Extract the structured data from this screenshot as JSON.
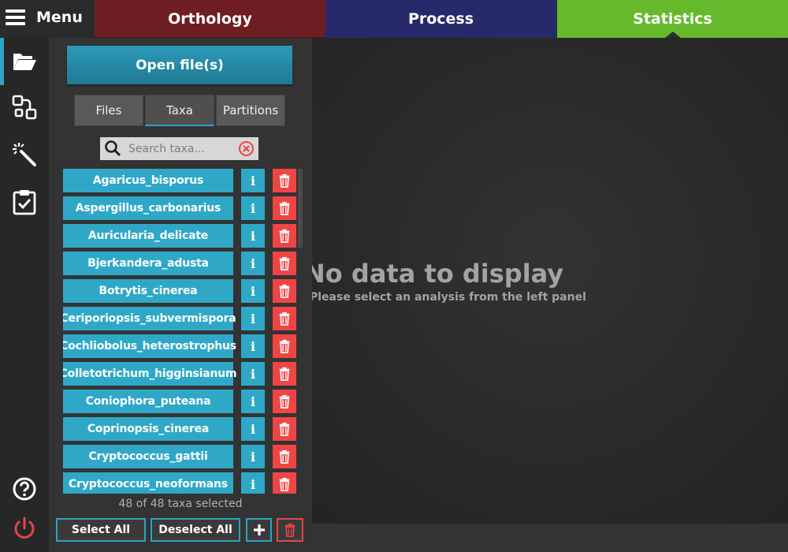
{
  "menu": {
    "label": "Menu"
  },
  "tabs": [
    {
      "label": "Orthology",
      "color": "#6e1e22"
    },
    {
      "label": "Process",
      "color": "#272a6a"
    },
    {
      "label": "Statistics",
      "color": "#65b92b",
      "active": true
    }
  ],
  "rail": [
    {
      "icon": "folder-open-icon",
      "active": true
    },
    {
      "icon": "workflow-icon"
    },
    {
      "icon": "magic-wand-icon"
    },
    {
      "icon": "clipboard-check-icon"
    },
    {
      "icon": "help-icon"
    },
    {
      "icon": "power-icon"
    }
  ],
  "panel": {
    "open_button": "Open file(s)",
    "tabs": [
      {
        "label": "Files"
      },
      {
        "label": "Taxa",
        "active": true
      },
      {
        "label": "Partitions"
      }
    ],
    "search_placeholder": "Search taxa...",
    "taxa": [
      "Agaricus_bisporus",
      "Aspergillus_carbonarius",
      "Auricularia_delicate",
      "Bjerkandera_adusta",
      "Botrytis_cinerea",
      "Ceriporiopsis_subvermispora",
      "Cochliobolus_heterostrophus",
      "Colletotrichum_higginsianum",
      "Coniophora_puteana",
      "Coprinopsis_cinerea",
      "Cryptococcus_gattii",
      "Cryptococcus_neoformans"
    ],
    "info_glyph": "i",
    "selection_count": "48 of 48 taxa selected",
    "select_all": "Select All",
    "deselect_all": "Deselect All"
  },
  "main": {
    "empty_title": "No data to display",
    "empty_subtitle": "Please select an analysis from the left panel"
  },
  "colors": {
    "accent": "#2ca3c4",
    "danger": "#f04545",
    "item": "#2fa8c8"
  }
}
